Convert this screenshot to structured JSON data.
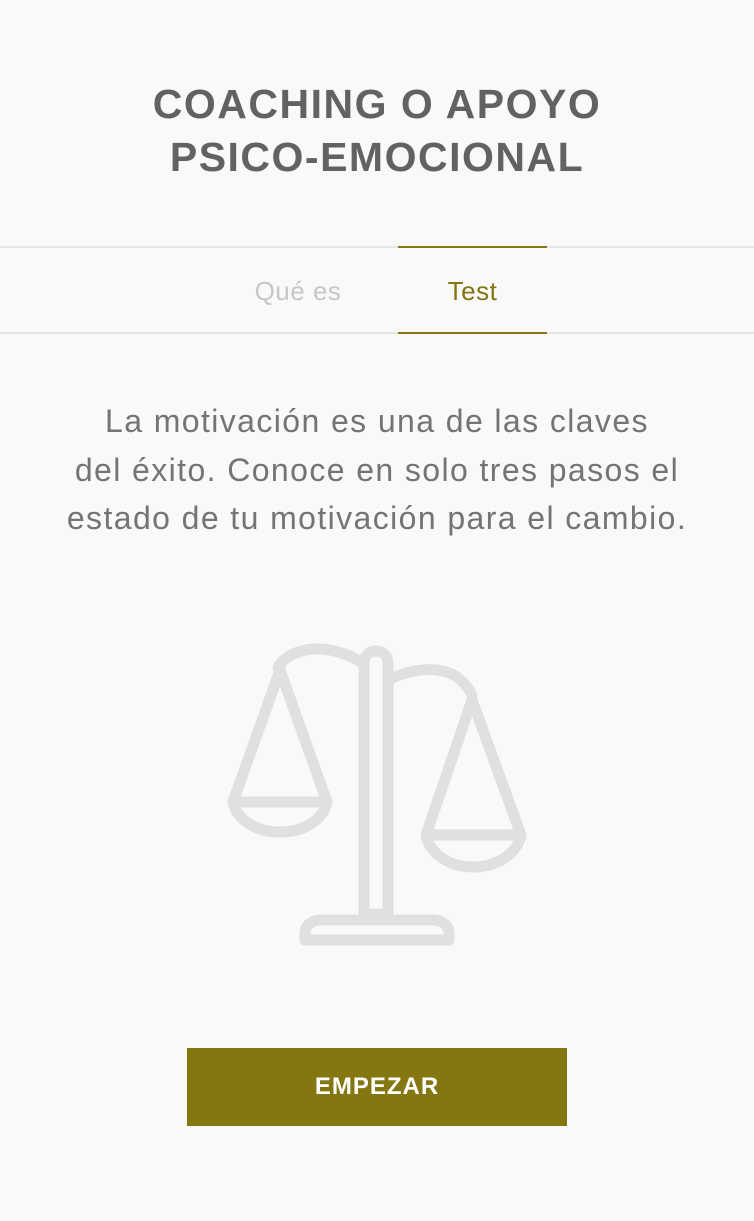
{
  "header": {
    "title_line1": "COACHING O APOYO",
    "title_line2": "PSICO-EMOCIONAL"
  },
  "tabs": [
    {
      "label": "Qué es",
      "active": false
    },
    {
      "label": "Test",
      "active": true
    }
  ],
  "main": {
    "description_line1": "La motivación es una de las claves",
    "description_line2": "del éxito. Conoce en solo tres pasos el",
    "description_line3": "estado de tu motivación para el cambio.",
    "illustration_icon": "balance-scale-icon",
    "start_button_label": "EMPEZAR"
  },
  "colors": {
    "accent": "#847711",
    "title": "#626262",
    "text": "#747474",
    "inactive_tab": "#c7c7c7",
    "icon": "#e0e0e0",
    "background": "#f9f9f9"
  }
}
